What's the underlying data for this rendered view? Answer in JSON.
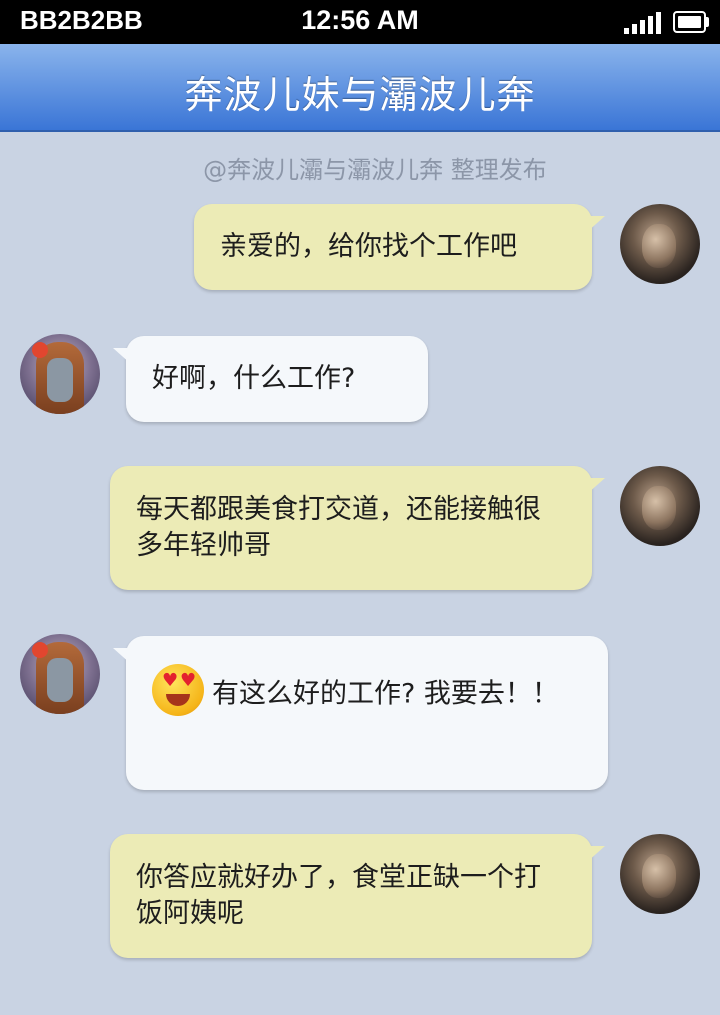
{
  "status_bar": {
    "carrier": "BB2B2BB",
    "time": "12:56 AM"
  },
  "header": {
    "title": "奔波儿妹与灞波儿奔"
  },
  "attribution": "@奔波儿灞与灞波儿奔 整理发布",
  "messages": [
    {
      "sender": "male",
      "text": "亲爱的，给你找个工作吧"
    },
    {
      "sender": "female",
      "text": "好啊，什么工作?"
    },
    {
      "sender": "male",
      "text": "每天都跟美食打交道，还能接触很多年轻帅哥"
    },
    {
      "sender": "female",
      "emoji": "heart-eyes-emoji",
      "text": "有这么好的工作? 我要去！！"
    },
    {
      "sender": "male",
      "text": "你答应就好办了，食堂正缺一个打饭阿姨呢"
    }
  ]
}
